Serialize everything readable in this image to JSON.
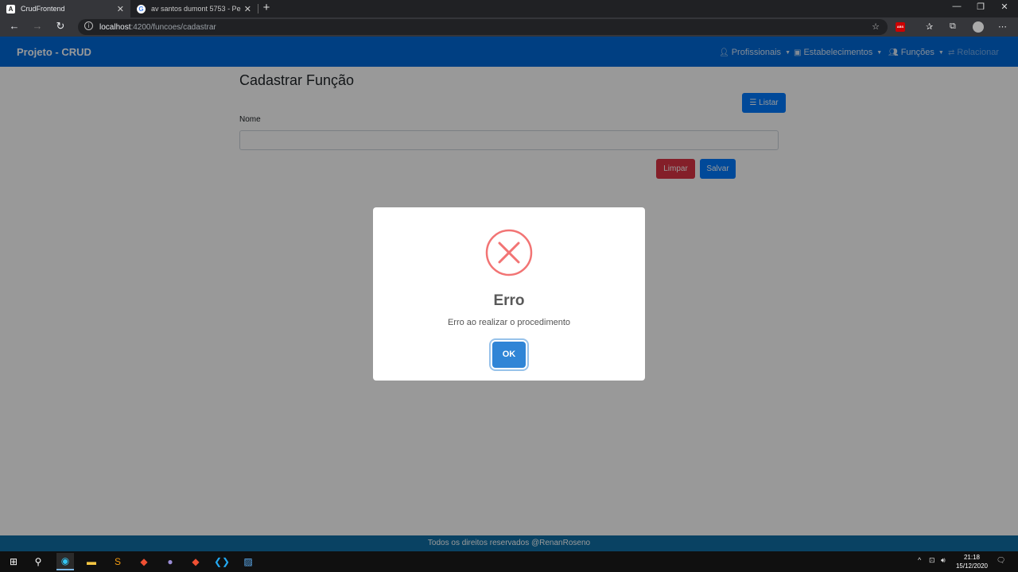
{
  "browser": {
    "tabs": [
      {
        "title": "CrudFrontend",
        "favicon": "A",
        "active": true
      },
      {
        "title": "av santos dumont 5753 - Pesqui",
        "favicon": "G",
        "active": false
      }
    ],
    "url_host": "localhost",
    "url_path": ":4200/funcoes/cadastrar"
  },
  "app": {
    "brand": "Projeto - CRUD",
    "nav": [
      {
        "label": "Profissionais",
        "icon": "user-icon"
      },
      {
        "label": "Estabelecimentos",
        "icon": "store-icon"
      },
      {
        "label": "Funções",
        "icon": "users-icon"
      },
      {
        "label": "Relacionar",
        "icon": "exchange-icon"
      }
    ]
  },
  "form": {
    "title": "Cadastrar Função",
    "list_button": "Listar",
    "name_label": "Nome",
    "name_value": "",
    "clear_button": "Limpar",
    "save_button": "Salvar"
  },
  "modal": {
    "title": "Erro",
    "message": "Erro ao realizar o procedimento",
    "ok_button": "OK",
    "icon": "error-x-icon"
  },
  "footer": {
    "text": "Todos os direitos reservados @RenanRoseno"
  },
  "taskbar": {
    "time": "21:18",
    "date": "15/12/2020"
  },
  "colors": {
    "navbar": "#0069d9",
    "primary": "#007bff",
    "danger": "#dc3545",
    "footer": "#0f6fa6",
    "error_icon": "#f27474",
    "ok_button": "#3085d6"
  }
}
